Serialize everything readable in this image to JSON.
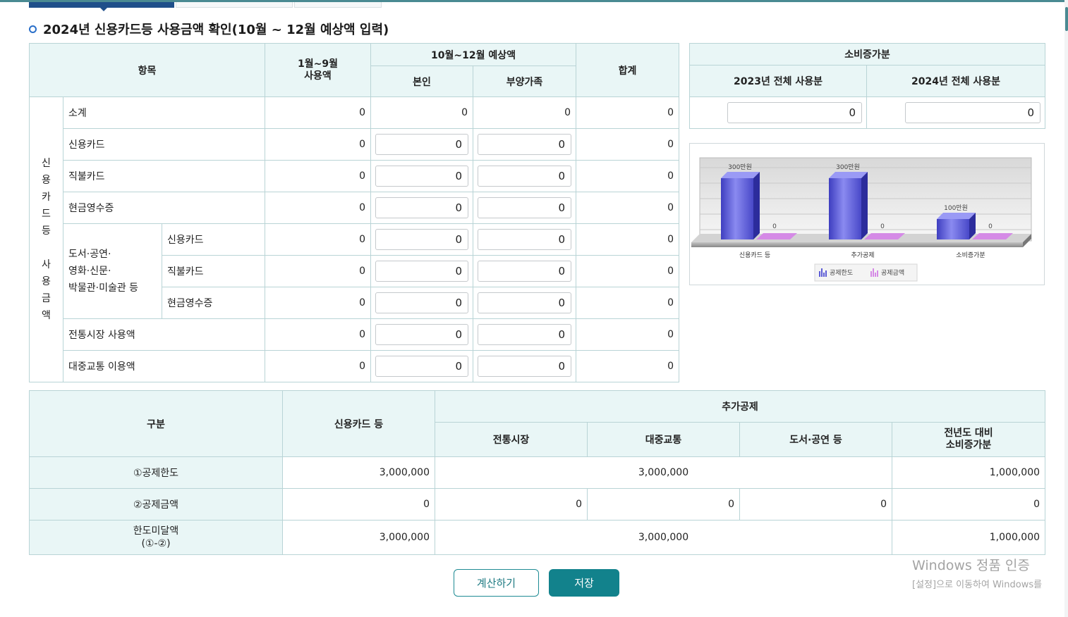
{
  "section": {
    "title": "2024년 신용카드등 사용금액 확인(10월 ~ 12월 예상액 입력)"
  },
  "usage_table": {
    "headers": {
      "item": "항목",
      "jan_sep": "1월~9월\n사용액",
      "estimate_group": "10월~12월 예상액",
      "self": "본인",
      "dependents": "부양가족",
      "total": "합계"
    },
    "group_label_top": [
      "신",
      "용",
      "카",
      "드",
      "등"
    ],
    "group_label_bottom": [
      "사",
      "용",
      "금",
      "액"
    ],
    "rows": [
      {
        "label": "소계",
        "jan_sep": "0",
        "self": "0",
        "dependents": "0",
        "total": "0"
      },
      {
        "label": "신용카드",
        "jan_sep": "0",
        "self": "0",
        "dependents": "0",
        "total": "0"
      },
      {
        "label": "직불카드",
        "jan_sep": "0",
        "self": "0",
        "dependents": "0",
        "total": "0"
      },
      {
        "label": "현금영수증",
        "jan_sep": "0",
        "self": "0",
        "dependents": "0",
        "total": "0"
      }
    ],
    "culture_group": {
      "label_lines": [
        "도서·공연·",
        "영화·신문·",
        "박물관·미술관 등"
      ],
      "rows": [
        {
          "label": "신용카드",
          "jan_sep": "0",
          "self": "0",
          "dependents": "0",
          "total": "0"
        },
        {
          "label": "직불카드",
          "jan_sep": "0",
          "self": "0",
          "dependents": "0",
          "total": "0"
        },
        {
          "label": "현금영수증",
          "jan_sep": "0",
          "self": "0",
          "dependents": "0",
          "total": "0"
        }
      ]
    },
    "tail_rows": [
      {
        "label": "전통시장 사용액",
        "jan_sep": "0",
        "self": "0",
        "dependents": "0",
        "total": "0"
      },
      {
        "label": "대중교통 이용액",
        "jan_sep": "0",
        "self": "0",
        "dependents": "0",
        "total": "0"
      }
    ]
  },
  "consumption": {
    "header": "소비증가분",
    "col_2023": "2023년 전체 사용분",
    "col_2024": "2024년 전체 사용분",
    "value_2023": "0",
    "value_2024": "0"
  },
  "chart_data": {
    "type": "bar",
    "categories": [
      "신용카드 등",
      "추가공제",
      "소비증가분"
    ],
    "series": [
      {
        "name": "공제한도",
        "values": [
          3000000,
          3000000,
          1000000
        ],
        "labels": [
          "300만원",
          "300만원",
          "100만원"
        ],
        "color": "#5c5cd6"
      },
      {
        "name": "공제금액",
        "values": [
          0,
          0,
          0
        ],
        "labels": [
          "0",
          "0",
          "0"
        ],
        "color": "#d58ae6"
      }
    ],
    "ylim": [
      0,
      3000000
    ],
    "legend": "bottom-center",
    "grid": true
  },
  "deduction_table": {
    "headers": {
      "category": "구분",
      "credit": "신용카드 등",
      "additional": "추가공제",
      "market": "전통시장",
      "transit": "대중교통",
      "culture": "도서·공연 등",
      "increase": "전년도 대비\n소비증가분"
    },
    "rows": {
      "limit": {
        "label": "①공제한도",
        "credit": "3,000,000",
        "additional": "3,000,000",
        "increase": "1,000,000"
      },
      "amount": {
        "label": "②공제금액",
        "credit": "0",
        "market": "0",
        "transit": "0",
        "culture": "0",
        "increase": "0"
      },
      "remaining": {
        "label": "한도미달액\n(①-②)",
        "credit": "3,000,000",
        "additional": "3,000,000",
        "increase": "1,000,000"
      }
    }
  },
  "buttons": {
    "calculate": "계산하기",
    "save": "저장"
  },
  "watermark": {
    "line1": "Windows 정품 인증",
    "line2": "[설정]으로 이동하여 Windows를"
  },
  "colors": {
    "accent": "#12828c",
    "header_bg": "#e9f6f6",
    "border": "#b9d4d6",
    "title_bullet": "#2a6fc9"
  }
}
